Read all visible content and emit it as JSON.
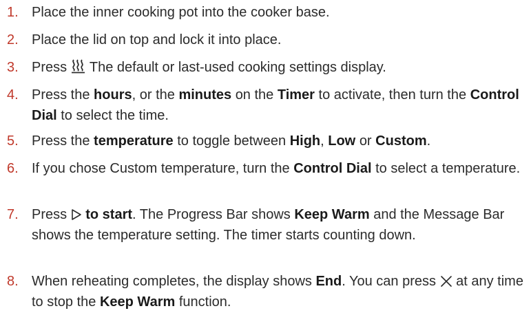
{
  "colors": {
    "number": "#c0392b",
    "text": "#2b2b2b",
    "emphasis": "#1a1a1a"
  },
  "steps": [
    {
      "number": "1.",
      "parts": [
        "Place the inner cooking pot into the cooker base."
      ]
    },
    {
      "number": "2.",
      "parts": [
        "Place the lid on top and lock it into place."
      ]
    },
    {
      "number": "3.",
      "parts": [
        "Press",
        "The default or last-used cooking settings display."
      ],
      "icon": "reheat-steam-icon"
    },
    {
      "number": "4.",
      "parts": [
        "Press the",
        "hours",
        ", or the",
        "minutes",
        "on the",
        "Timer",
        "to activate, then turn the",
        "Control Dial",
        "to select the time."
      ]
    },
    {
      "number": "5.",
      "parts": [
        "Press the",
        "temperature",
        "to toggle between",
        "High",
        ",",
        "Low",
        "or",
        "Custom",
        "."
      ]
    },
    {
      "number": "6.",
      "parts": [
        "If you chose Custom temperature, turn the",
        "Control Dial",
        "to select a temperature."
      ]
    },
    {
      "number": "7.",
      "parts": [
        "Press",
        "to start",
        ". The Progress Bar shows",
        "Keep Warm",
        "and the Message Bar shows the temperature setting. The timer starts counting down."
      ],
      "icon": "play-triangle-icon"
    },
    {
      "number": "8.",
      "parts": [
        "When reheating completes, the display shows",
        "End",
        ". You can press",
        "at any time to stop the",
        "Keep Warm",
        "function."
      ],
      "icon": "cancel-x-icon"
    }
  ]
}
